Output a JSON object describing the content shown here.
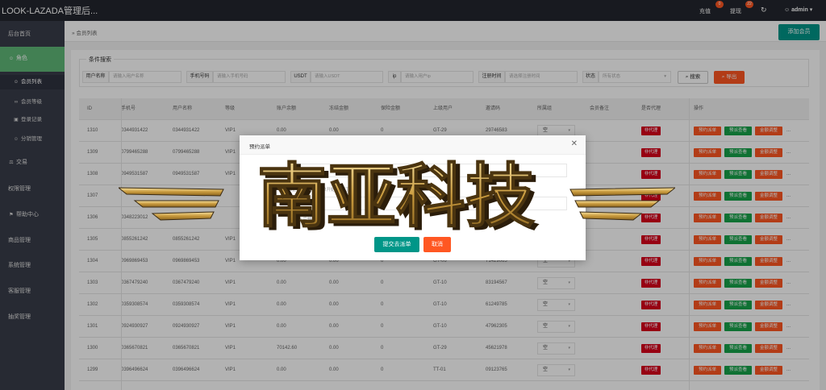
{
  "header": {
    "brand": "LOOK-LAZADA管理后...",
    "recharge_label": "充值",
    "recharge_badge": "0",
    "withdraw_label": "提现",
    "withdraw_badge": "22",
    "refresh_icon": "refresh-icon",
    "user_icon": "user-icon",
    "user_name": "admin",
    "caret_icon": "caret-down-icon"
  },
  "sidebar": {
    "items": [
      {
        "label": "后台首页",
        "icon": ""
      },
      {
        "label": "角色",
        "icon": "user-icon"
      },
      {
        "label": "交易",
        "icon": "balance-icon"
      },
      {
        "label": "权限管理",
        "icon": ""
      },
      {
        "label": "帮助中心",
        "icon": "flag-icon"
      },
      {
        "label": "商品管理",
        "icon": ""
      },
      {
        "label": "系统管理",
        "icon": ""
      },
      {
        "label": "客服管理",
        "icon": ""
      },
      {
        "label": "抽奖管理",
        "icon": ""
      }
    ],
    "subitems": [
      {
        "label": "会员列表",
        "icon": "user-icon"
      },
      {
        "label": "会员等级",
        "icon": "link-icon"
      },
      {
        "label": "登录记录",
        "icon": "lock-icon"
      },
      {
        "label": "分销管理",
        "icon": "users-icon"
      }
    ]
  },
  "breadcrumb": {
    "text": "会员列表",
    "add_button": "添加会员"
  },
  "filter": {
    "legend": "条件搜索",
    "username_label": "用户名称",
    "username_placeholder": "请输入用户名称",
    "phone_label": "手机号码",
    "phone_placeholder": "请输入手机号码",
    "usdt_label": "USDT",
    "usdt_placeholder": "请输入USDT",
    "ip_label": "ip",
    "ip_placeholder": "请输入用户ip",
    "regtime_label": "注册时间",
    "regtime_placeholder": "请选择注册时间",
    "status_label": "状态",
    "status_value": "所有状态",
    "search_button": "搜索",
    "export_button": "导出"
  },
  "table": {
    "headers": [
      "ID",
      "手机号",
      "用户名称",
      "等级",
      "账户余额",
      "冻结金额",
      "保险金额",
      "上级用户",
      "邀请码",
      "所属组",
      "会员备注",
      "是否代理",
      "操作"
    ],
    "rows": [
      {
        "id": "1310",
        "phone": "0344931422",
        "name": "0344931422",
        "level": "VIP1",
        "balance": "0.00",
        "frozen": "0.00",
        "insurance": "0",
        "parent": "GT-29",
        "code": "29746583",
        "group": "空",
        "agent": "非代理"
      },
      {
        "id": "1309",
        "phone": "0799465288",
        "name": "0799465288",
        "level": "VIP1",
        "balance": "",
        "frozen": "",
        "insurance": "",
        "parent": "",
        "code": "",
        "group": "",
        "agent": "非代理"
      },
      {
        "id": "1308",
        "phone": "0949531587",
        "name": "0949531587",
        "level": "VIP1",
        "balance": "",
        "frozen": "",
        "insurance": "",
        "parent": "",
        "code": "",
        "group": "",
        "agent": "非代理"
      },
      {
        "id": "1307",
        "phone": "",
        "name": "",
        "level": "",
        "balance": "",
        "frozen": "",
        "insurance": "",
        "parent": "",
        "code": "",
        "group": "",
        "agent": "非代理"
      },
      {
        "id": "1306",
        "phone": "0348223012",
        "name": "",
        "level": "",
        "balance": "",
        "frozen": "",
        "insurance": "",
        "parent": "",
        "code": "",
        "group": "",
        "agent": "非代理"
      },
      {
        "id": "1305",
        "phone": "0855261242",
        "name": "0855261242",
        "level": "VIP1",
        "balance": "",
        "frozen": "",
        "insurance": "",
        "parent": "",
        "code": "",
        "group": "",
        "agent": "非代理"
      },
      {
        "id": "1304",
        "phone": "0969869453",
        "name": "0969869453",
        "level": "VIP1",
        "balance": "0.00",
        "frozen": "0.00",
        "insurance": "0",
        "parent": "GT-06",
        "code": "71429065",
        "group": "空",
        "agent": "非代理"
      },
      {
        "id": "1303",
        "phone": "0367479240",
        "name": "0367479240",
        "level": "VIP1",
        "balance": "0.00",
        "frozen": "0.00",
        "insurance": "0",
        "parent": "GT-10",
        "code": "83194567",
        "group": "空",
        "agent": "非代理"
      },
      {
        "id": "1302",
        "phone": "0359308574",
        "name": "0359308574",
        "level": "VIP1",
        "balance": "0.00",
        "frozen": "0.00",
        "insurance": "0",
        "parent": "GT-10",
        "code": "61249785",
        "group": "空",
        "agent": "非代理"
      },
      {
        "id": "1301",
        "phone": "0924930927",
        "name": "0924930927",
        "level": "VIP1",
        "balance": "0.00",
        "frozen": "0.00",
        "insurance": "0",
        "parent": "GT-10",
        "code": "47962305",
        "group": "空",
        "agent": "非代理"
      },
      {
        "id": "1300",
        "phone": "0365670821",
        "name": "0365670821",
        "level": "VIP1",
        "balance": "70142.60",
        "frozen": "0.00",
        "insurance": "0",
        "parent": "GT-29",
        "code": "45621978",
        "group": "空",
        "agent": "非代理"
      },
      {
        "id": "1299",
        "phone": "0396496624",
        "name": "0396496624",
        "level": "VIP1",
        "balance": "0.00",
        "frozen": "0.00",
        "insurance": "0",
        "parent": "TT-01",
        "code": "09123765",
        "group": "空",
        "agent": "非代理"
      }
    ],
    "actions": {
      "reserve": "预约派单",
      "preview": "预派查看",
      "adjust": "金额调整",
      "more": "..."
    }
  },
  "modal": {
    "title": "预约派单",
    "close_icon": "close-icon",
    "field_label": "订单数：",
    "field_value": "0",
    "row2_value": "0.00",
    "hint1": "0正确派单，第N单开始预约订单",
    "hint2": "请输入完整后",
    "submit": "提交去派单",
    "cancel": "取消"
  },
  "watermark": {
    "text": "南亚科技"
  },
  "colors": {
    "topbar": "#23262e",
    "sidebar": "#393d49",
    "active_green": "#5fb878",
    "teal": "#009688",
    "orange": "#ff5722",
    "red": "#d9001b",
    "green_tag": "#16a34a"
  }
}
